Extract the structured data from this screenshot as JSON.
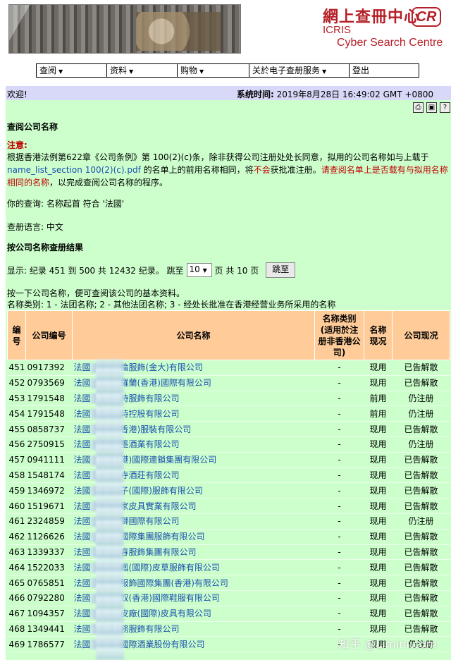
{
  "banner": {
    "title_cn": "網上查冊中心",
    "icris": "ICRIS",
    "cyber": "Cyber Search Centre",
    "logo": "CR"
  },
  "menu": [
    {
      "label": "查阅",
      "has_caret": true
    },
    {
      "label": "资料",
      "has_caret": true
    },
    {
      "label": "购物",
      "has_caret": true
    },
    {
      "label": "关於电子查册服务",
      "has_caret": true
    },
    {
      "label": "登出",
      "has_caret": false
    }
  ],
  "topbar": {
    "welcome": "欢迎!",
    "systime_label": "系统时间:",
    "systime_value": "2019年8月28日 16:49:02 GMT +0800"
  },
  "tools": [
    {
      "icon": "printer-icon"
    },
    {
      "icon": "save-icon"
    },
    {
      "icon": "help-icon"
    }
  ],
  "page": {
    "title": "查阅公司名称",
    "notice_label": "注意:",
    "notice_1": "根据香港法例第622章《公司条例》第 100(2)(c)条，除非获得公司注册处处长同意，拟用的公司名称如与上载于 ",
    "notice_link": "name_list_section 100(2)(c).pdf",
    "notice_2": " 的名单上的前用名称相同，将",
    "notice_red1": "不会",
    "notice_3": "获批准注册。",
    "notice_red2": "请查阅名单上是否载有与拟用名称相同的名称",
    "notice_4": "，以完成查阅公司名称的程序。",
    "query": "你的查询:  名称起首 符合 '法國'",
    "language": "查册语言: 中文",
    "result_title": "按公司名称查册结果",
    "paging_text": "显示: 纪录 451 到 500 共 12432 纪录。 跳至",
    "paging_select": "10",
    "paging_total": "页  共 10 页",
    "jump_label": "跳至",
    "hint1": "按一下公司名称，便可查阅该公司的基本资料。",
    "hint2": "名称类别: 1 - 法团名称; 2 - 其他法团名称; 3 - 经处长批准在香港经营业务所采用的名称"
  },
  "table": {
    "headers": [
      "编号",
      "公司编号",
      "公司名称",
      "名称类别(适用於注册非香港公司)",
      "名称现况",
      "公司现况"
    ],
    "header_lines": {
      "no": [
        "编",
        "号"
      ],
      "type": [
        "名称类别",
        "(适用於注",
        "册非香港公",
        "司)"
      ],
      "status": [
        "名称",
        "现况"
      ]
    },
    "rows": [
      {
        "no": "451",
        "code": "0917392",
        "prefix": "法國",
        "name": "倫服飾(金大)有限公司",
        "type": "-",
        "status": "现用",
        "company": "已告解散"
      },
      {
        "no": "452",
        "code": "0793569",
        "prefix": "法國",
        "name": "羅蘭(香港)國際有限公司",
        "type": "-",
        "status": "现用",
        "company": "已告解散"
      },
      {
        "no": "453",
        "code": "1791548",
        "prefix": "法國",
        "name": "時服飾有限公司",
        "type": "-",
        "status": "前用",
        "company": "仍注册"
      },
      {
        "no": "454",
        "code": "1791548",
        "prefix": "法國",
        "name": "時控股有限公司",
        "type": "-",
        "status": "前用",
        "company": "仍注册"
      },
      {
        "no": "455",
        "code": "0858737",
        "prefix": "法國",
        "name": "香港)服裝有限公司",
        "type": "-",
        "status": "现用",
        "company": "已告解散"
      },
      {
        "no": "456",
        "code": "2750915",
        "prefix": "法國",
        "name": "墨酒業有限公司",
        "type": "-",
        "status": "现用",
        "company": "仍注册"
      },
      {
        "no": "457",
        "code": "0941111",
        "prefix": "法國",
        "name": "港)國際連鎖集團有限公司",
        "type": "-",
        "status": "现用",
        "company": "已告解散"
      },
      {
        "no": "458",
        "code": "1548174",
        "prefix": "法國",
        "name": "寺酒莊有限公司",
        "type": "-",
        "status": "现用",
        "company": "已告解散"
      },
      {
        "no": "459",
        "code": "1346972",
        "prefix": "法國",
        "name": "子(國際)服飾有限公司",
        "type": "-",
        "status": "现用",
        "company": "已告解散"
      },
      {
        "no": "460",
        "code": "1519671",
        "prefix": "法國",
        "name": "家皮具實業有限公司",
        "type": "-",
        "status": "现用",
        "company": "已告解散"
      },
      {
        "no": "461",
        "code": "2324859",
        "prefix": "法國",
        "name": "獅國際有限公司",
        "type": "-",
        "status": "现用",
        "company": "仍注册"
      },
      {
        "no": "462",
        "code": "1126626",
        "prefix": "法國",
        "name": "國際集團服飾有限公司",
        "type": "-",
        "status": "现用",
        "company": "已告解散"
      },
      {
        "no": "463",
        "code": "1339337",
        "prefix": "法國",
        "name": "春服飾集團有限公司",
        "type": "-",
        "status": "现用",
        "company": "已告解散"
      },
      {
        "no": "464",
        "code": "1522033",
        "prefix": "法國",
        "name": "鳳(國際)皮草服飾有限公司",
        "type": "-",
        "status": "现用",
        "company": "已告解散"
      },
      {
        "no": "465",
        "code": "0765851",
        "prefix": "法國",
        "name": "服飾國際集團(香港)有限公司",
        "type": "-",
        "status": "现用",
        "company": "已告解散"
      },
      {
        "no": "466",
        "code": "0792280",
        "prefix": "法國",
        "name": "奴(香港)國際鞋服有限公司",
        "type": "-",
        "status": "现用",
        "company": "已告解散"
      },
      {
        "no": "467",
        "code": "1094357",
        "prefix": "法國",
        "name": "皮廠(國際)皮具有限公司",
        "type": "-",
        "status": "现用",
        "company": "已告解散"
      },
      {
        "no": "468",
        "code": "1349441",
        "prefix": "法國",
        "name": "務服飾有限公司",
        "type": "-",
        "status": "现用",
        "company": "已告解散"
      },
      {
        "no": "469",
        "code": "1786577",
        "prefix": "法國",
        "name": "國際酒業股份有限公司",
        "type": "-",
        "status": "现用",
        "company": "仍注册"
      }
    ]
  },
  "watermark": "知乎 @Limini.com"
}
